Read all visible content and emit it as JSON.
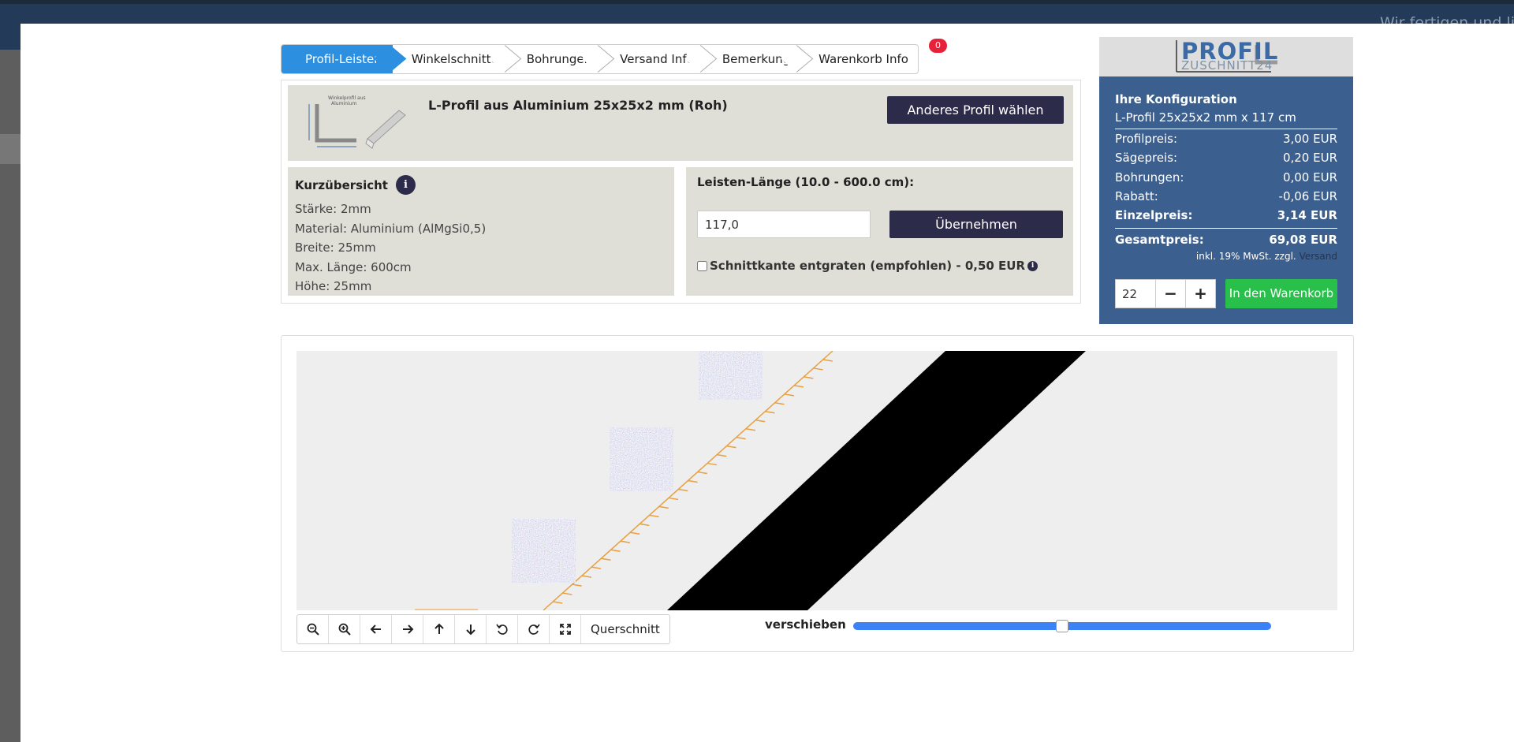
{
  "header": {
    "tagline": "Wir fertigen und li"
  },
  "steps": [
    {
      "label": "Profil-Leisten"
    },
    {
      "label": "Winkelschnitte"
    },
    {
      "label": "Bohrungen"
    },
    {
      "label": "Versand Info"
    },
    {
      "label": "Bemerkung"
    },
    {
      "label": "Warenkorb Info"
    }
  ],
  "cart_count": "0",
  "profile": {
    "title": "L-Profil aus Aluminium 25x25x2 mm (Roh)",
    "thumb_caption": "Winkelprofil aus Aluminium",
    "change_button": "Anderes Profil wählen"
  },
  "summary": {
    "heading": "Kurzübersicht",
    "info_glyph": "i",
    "rows": [
      "Stärke: 2mm",
      "Material: Aluminium (AlMgSi0,5)",
      "Breite: 25mm",
      "Max. Länge: 600cm",
      "Höhe: 25mm"
    ]
  },
  "length": {
    "label": "Leisten-Länge (10.0 - 600.0 cm):",
    "value": "117,0",
    "apply_button": "Übernehmen",
    "deburr_label": "Schnittkante entgraten (empfohlen) - 0,50 EUR",
    "deburr_checked": false
  },
  "config": {
    "logo_word": "PROFIL",
    "logo_sub": "ZUSCHNITT24",
    "title": "Ihre Konfiguration",
    "subtitle": "L-Profil 25x25x2 mm x 117 cm",
    "prices": [
      {
        "label": "Profilpreis:",
        "value": "3,00 EUR",
        "bold": false
      },
      {
        "label": "Sägepreis:",
        "value": "0,20 EUR",
        "bold": false
      },
      {
        "label": "Bohrungen:",
        "value": "0,00 EUR",
        "bold": false
      },
      {
        "label": "Rabatt:",
        "value": "-0,06 EUR",
        "bold": false
      },
      {
        "label": "Einzelpreis:",
        "value": "3,14 EUR",
        "bold": true
      }
    ],
    "total_label": "Gesamtpreis:",
    "total_value": "69,08 EUR",
    "vat_note": "inkl. 19% MwSt. zzgl.",
    "shipping_link": "Versand",
    "quantity": "22",
    "minus": "−",
    "plus": "+",
    "cart_button": "In den Warenkorb"
  },
  "viewer": {
    "cross_section_button": "Querschnitt",
    "move_label": "verschieben",
    "slider_value": 0.5,
    "tools": [
      "zoom-out-icon",
      "zoom-in-icon",
      "arrow-left-icon",
      "arrow-right-icon",
      "arrow-up-icon",
      "arrow-down-icon",
      "rotate-left-icon",
      "rotate-right-icon",
      "fullscreen-icon"
    ]
  },
  "colors": {
    "active_step": "#2c8fe0",
    "dark_button": "#2c2b4a",
    "config_panel": "#3b5f8e",
    "cart_button": "#28c04a",
    "slider": "#3b82f6",
    "dimension_line": "#e8a040"
  }
}
